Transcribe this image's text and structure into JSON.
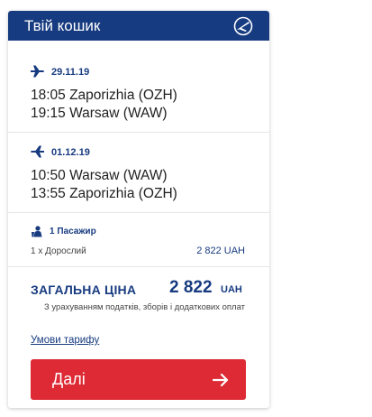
{
  "cart": {
    "title": "Твій кошик",
    "logo_icon": "airline-logo-icon"
  },
  "flights": [
    {
      "icon": "plane-departure-icon",
      "date": "29.11.19",
      "departure": "18:05 Zaporizhia (OZH)",
      "arrival": "19:15 Warsaw (WAW)"
    },
    {
      "icon": "plane-return-icon",
      "date": "01.12.19",
      "departure": "10:50 Warsaw (WAW)",
      "arrival": "13:55 Zaporizhia (OZH)"
    }
  ],
  "passengers": {
    "icon": "passenger-icon",
    "count_label": "1 Пасажир",
    "type_label": "1 х Дорослий",
    "price": "2 822 UAH"
  },
  "total": {
    "label": "ЗАГАЛЬНА ЦІНА",
    "amount": "2 822",
    "currency": "UAH",
    "note": "З урахуванням податків, зборів і додаткових оплат"
  },
  "fare_link": "Умови тарифу",
  "next_button": {
    "label": "Далі",
    "icon": "arrow-right-icon"
  },
  "colors": {
    "brand": "#173b80",
    "button": "#dd2a34"
  }
}
